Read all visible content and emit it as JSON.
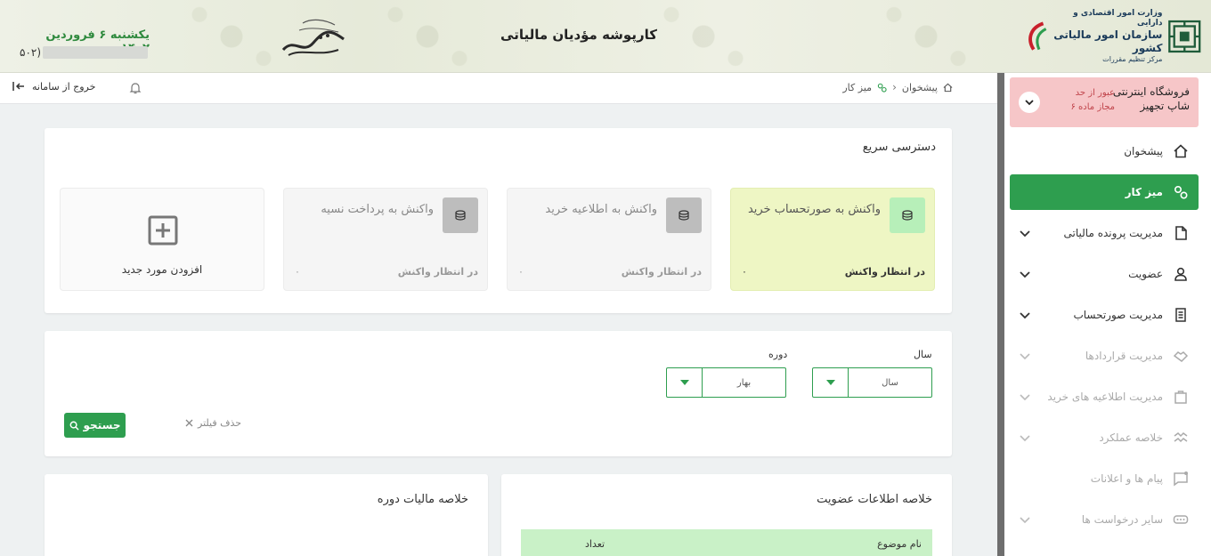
{
  "header": {
    "title": "کارپوشه مؤدیان مالیاتی",
    "date": "یکشنبه ۶ فروردین ۱۴۰۲",
    "user_id_prefix": "(۵۰۲",
    "org": {
      "line1": "وزارت امور اقتصادی و دارایی",
      "line2": "سازمان امور مالیاتی کشور",
      "line3": "مرکز تنظیم مقررات"
    }
  },
  "toolbar": {
    "logout_label": "خروج از سامانه",
    "breadcrumb": [
      "پیشخوان",
      "میز کار"
    ]
  },
  "sidebar": {
    "store": {
      "name": "فروشگاه اینترنتی شاپ تجهیز",
      "warning": "عبور از حد مجاز ماده ۶"
    },
    "items": [
      {
        "label": "پیشخوان",
        "icon": "home-icon",
        "state": "normal"
      },
      {
        "label": "میز کار",
        "icon": "workspace-icon",
        "state": "active"
      },
      {
        "label": "مدیریت پرونده مالیاتی",
        "icon": "file-icon",
        "state": "normal"
      },
      {
        "label": "عضویت",
        "icon": "user-icon",
        "state": "normal"
      },
      {
        "label": "مدیریت صورتحساب",
        "icon": "invoice-icon",
        "state": "normal"
      },
      {
        "label": "مدیریت قراردادها",
        "icon": "handshake-icon",
        "state": "disabled"
      },
      {
        "label": "مدیریت اطلاعیه های خرید",
        "icon": "bag-icon",
        "state": "disabled"
      },
      {
        "label": "خلاصه عملکرد",
        "icon": "chart-icon",
        "state": "disabled"
      },
      {
        "label": "پیام ها و اعلانات",
        "icon": "message-icon",
        "state": "disabled"
      },
      {
        "label": "سایر درخواست ها",
        "icon": "more-icon",
        "state": "disabled"
      }
    ]
  },
  "quick_access": {
    "title": "دسترسی سریع",
    "tiles": [
      {
        "label": "واکنش به صورتحساب خرید",
        "status": "در انتظار واکنش",
        "count": "۰",
        "active": true
      },
      {
        "label": "واکنش به اطلاعیه خرید",
        "status": "در انتظار واکنش",
        "count": "۰",
        "active": false
      },
      {
        "label": "واکنش به پرداخت نسیه",
        "status": "در انتظار واکنش",
        "count": "۰",
        "active": false
      }
    ],
    "add_label": "افزودن مورد جدید"
  },
  "filters": {
    "year_label": "سال",
    "year_value": "سال",
    "period_label": "دوره",
    "period_value": "بهار",
    "clear_label": "حذف فیلتر",
    "search_label": "جستجو"
  },
  "membership_summary": {
    "title": "خلاصه اطلاعات عضویت",
    "columns": [
      "نام موضوع",
      "تعداد"
    ]
  },
  "period_tax_summary": {
    "title": "خلاصه مالیات دوره"
  },
  "colors": {
    "accent": "#2e9e4f",
    "warning_bg": "#f6c6c8",
    "active_tile_bg": "#eef6c4"
  }
}
